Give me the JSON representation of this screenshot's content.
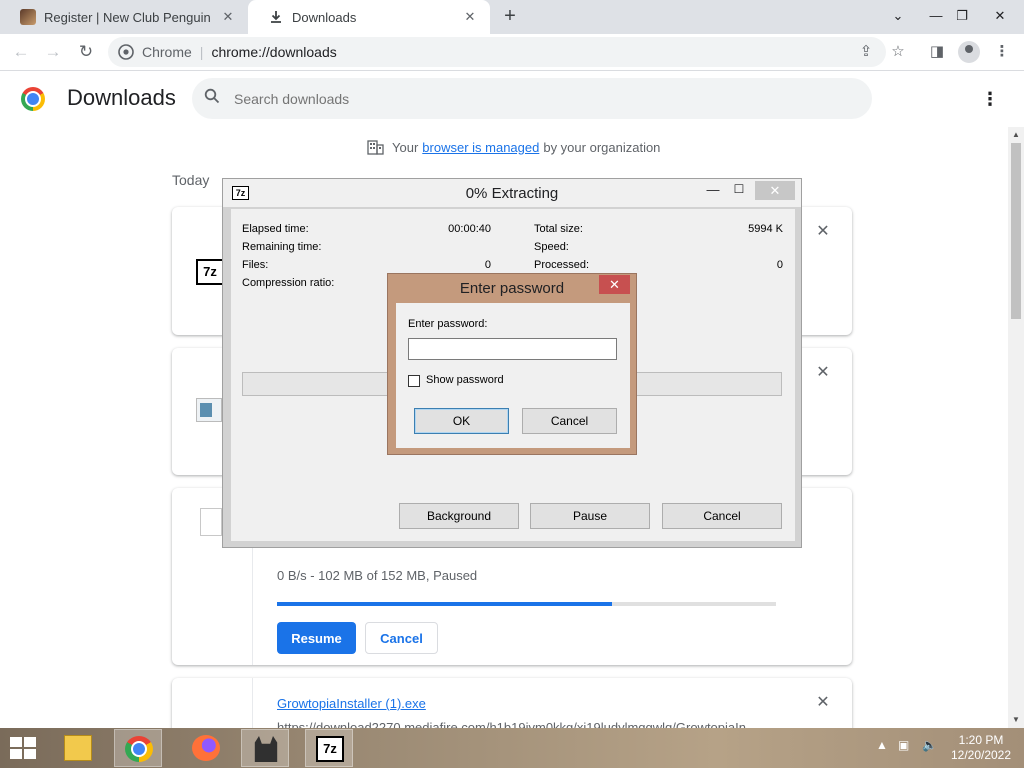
{
  "browser": {
    "tabs": [
      {
        "title": "Register | New Club Penguin",
        "active": false
      },
      {
        "title": "Downloads",
        "active": true
      }
    ],
    "omnibox": {
      "chip": "Chrome",
      "url": "chrome://downloads"
    }
  },
  "downloads_page": {
    "title": "Downloads",
    "search_placeholder": "Search downloads",
    "managed_prefix": "Your",
    "managed_link": "browser is managed",
    "managed_suffix": "by your organization",
    "section_label": "Today",
    "paused_item": {
      "status": "0 B/s - 102 MB of 152 MB, Paused",
      "progress_fraction": 0.671,
      "resume_label": "Resume",
      "cancel_label": "Cancel"
    },
    "last_item": {
      "filename": "GrowtopiaInstaller (1).exe",
      "url": "https://download2270.mediafire.com/h1b19jvm0kkg/xj19ludylmqgwlq/GrowtopiaIn..."
    }
  },
  "zip_progress": {
    "app_icon": "7z",
    "title": "0% Extracting",
    "left_labels": [
      "Elapsed time:",
      "Remaining time:",
      "Files:",
      "Compression ratio:"
    ],
    "left_values": [
      "00:00:40",
      "",
      "0",
      ""
    ],
    "right_labels": [
      "Total size:",
      "Speed:",
      "Processed:"
    ],
    "right_values": [
      "5994 K",
      "",
      "0"
    ],
    "buttons": {
      "background": "Background",
      "pause": "Pause",
      "cancel": "Cancel"
    }
  },
  "password_dialog": {
    "title": "Enter password",
    "label": "Enter password:",
    "value": "",
    "show_password_label": "Show password",
    "ok_label": "OK",
    "cancel_label": "Cancel"
  },
  "taskbar": {
    "apps": [
      "file-explorer",
      "chrome",
      "firefox",
      "cat-app",
      "7zip"
    ],
    "time": "1:20 PM",
    "date": "12/20/2022"
  }
}
